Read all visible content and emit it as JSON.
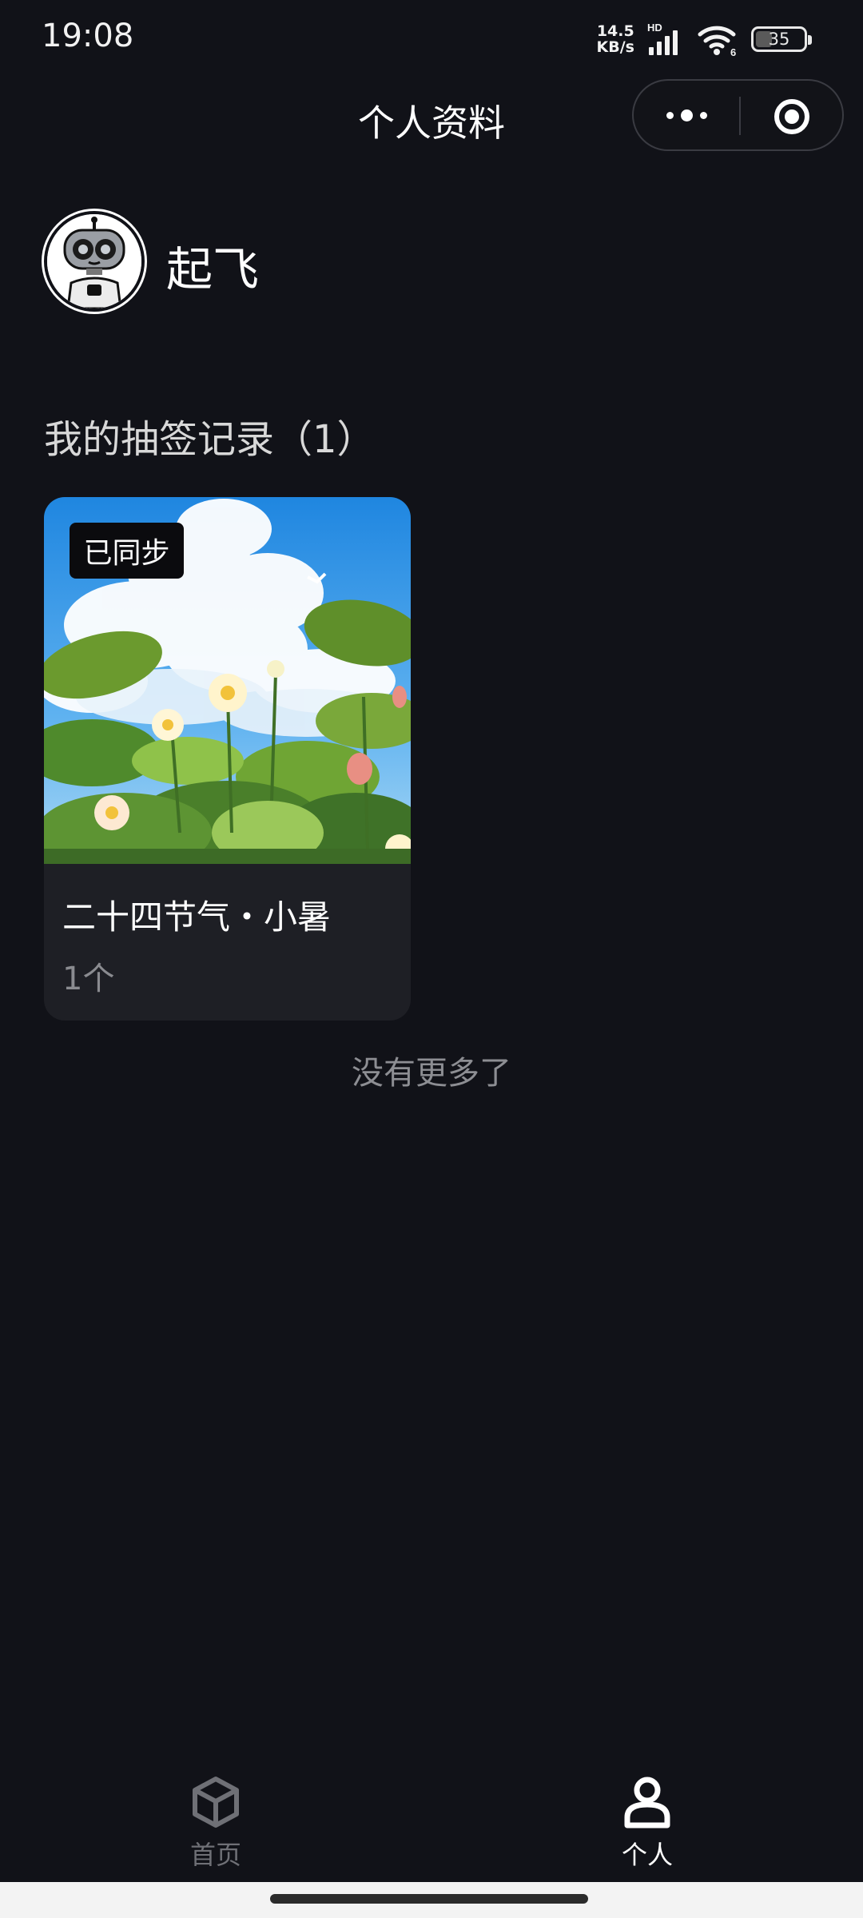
{
  "status_bar": {
    "time": "19:08",
    "net_speed_value": "14.5",
    "net_speed_unit": "KB/s",
    "signal_tag": "HD",
    "wifi_tag": "6",
    "battery": "35"
  },
  "nav": {
    "title": "个人资料",
    "more_icon": "more-dots-icon",
    "close_icon": "target-circle-icon"
  },
  "profile": {
    "name": "起飞",
    "avatar_icon": "robot-avatar"
  },
  "records": {
    "title": "我的抽签记录（1）",
    "items": [
      {
        "badge": "已同步",
        "title": "二十四节气・小暑",
        "count": "1个",
        "image": "lotus-pond-summer-sky-illustration"
      }
    ],
    "footer": "没有更多了"
  },
  "tabs": [
    {
      "label": "首页",
      "icon": "cube-icon",
      "active": false
    },
    {
      "label": "个人",
      "icon": "person-icon",
      "active": true
    }
  ],
  "colors": {
    "background": "#111218",
    "card": "#1e1f25",
    "muted_text": "#8a8b90",
    "inactive_tab": "#6f7076"
  }
}
